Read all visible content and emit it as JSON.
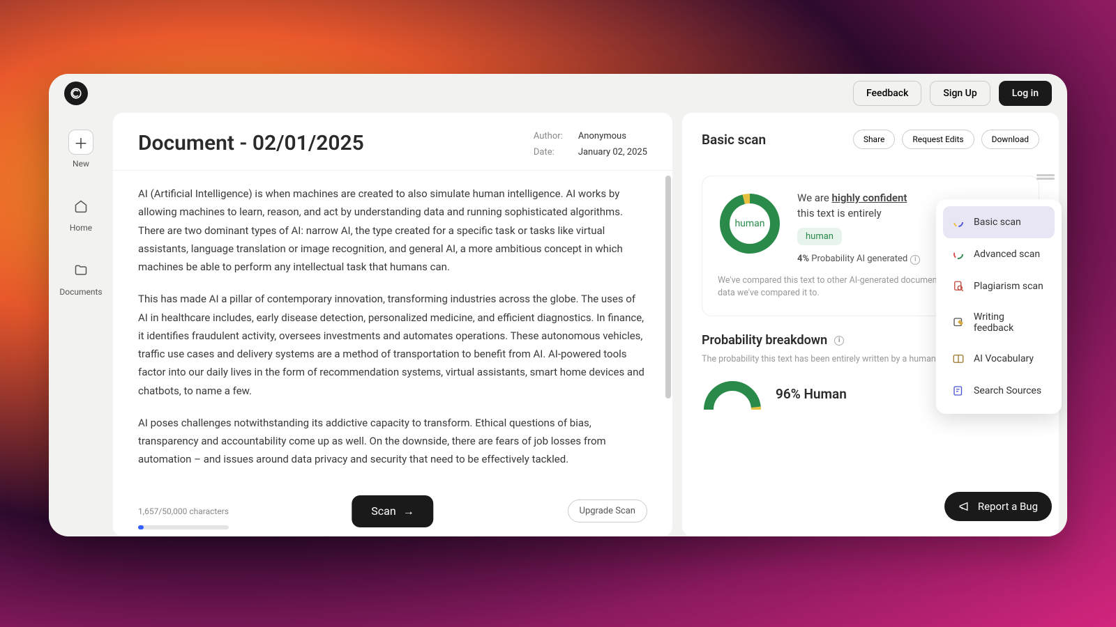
{
  "top": {
    "feedback": "Feedback",
    "signup": "Sign Up",
    "login": "Log in"
  },
  "sidebar": {
    "new": "New",
    "home": "Home",
    "documents": "Documents"
  },
  "doc": {
    "title": "Document - 02/01/2025",
    "author_label": "Author:",
    "author": "Anonymous",
    "date_label": "Date:",
    "date": "January 02, 2025",
    "p1": "AI (Artificial Intelligence) is when machines are created to also simulate human intelligence. AI works by allowing machines to learn, reason, and act by understanding data and running sophisticated algorithms. There are two dominant types of AI: narrow AI, the type created for a specific task or tasks like virtual assistants, language translation or image recognition, and general AI, a more ambitious concept in which machines be able to perform any intellectual task that humans can.",
    "p2": "This has made AI a pillar of contemporary innovation, transforming industries across the globe. The uses of AI in healthcare includes, early disease detection, personalized medicine, and efficient diagnostics. In finance, it identifies fraudulent activity, oversees investments and automates operations. These autonomous vehicles, traffic use cases and delivery systems are a method of transportation to benefit from AI. AI-powered tools factor into our daily lives in the form of recommendation systems, virtual assistants, smart home devices and chatbots, to name a few.",
    "p3": "AI poses challenges notwithstanding its addictive capacity to transform. Ethical questions of bias, transparency and accountability come up as well. On the downside, there are fears of job losses from automation – and issues around data privacy and security that need to be effectively tackled.",
    "charcount": "1,657/50,000 characters",
    "scan": "Scan",
    "upgrade": "Upgrade Scan"
  },
  "results": {
    "title": "Basic scan",
    "share": "Share",
    "request_edits": "Request Edits",
    "download": "Download",
    "confidence_prefix": "We are ",
    "confidence_highlight": "highly confident",
    "confidence_line2": "this text is entirely",
    "donut_label": "human",
    "badge": "human",
    "prob_pct": "4%",
    "prob_text": " Probability AI generated",
    "compare": "We've compared this text to other AI-generated documents. It's similar to the data we've compared it to.",
    "breakdown_title": "Probability breakdown",
    "breakdown_sub": "The probability this text has been entirely written by a human, AI or a mix of the two.",
    "human_line": "96% Human"
  },
  "menu": {
    "basic": "Basic scan",
    "advanced": "Advanced scan",
    "plagiarism": "Plagiarism scan",
    "writing": "Writing feedback",
    "vocab": "AI Vocabulary",
    "sources": "Search Sources"
  },
  "footer": {
    "report_bug": "Report a Bug"
  }
}
